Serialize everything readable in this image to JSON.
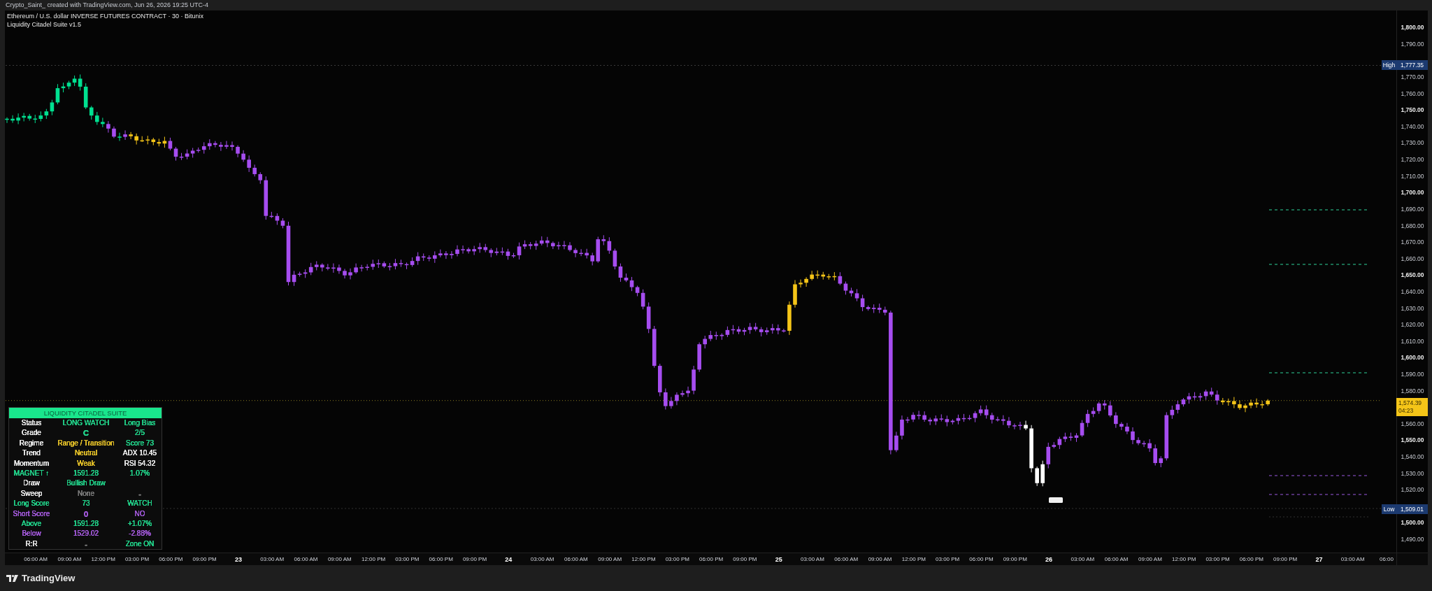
{
  "caption": "Crypto_Saint_ created with TradingView.com, Jun 26, 2026 19:25 UTC-4",
  "legend": {
    "symbol": "Ethereum / U.S. dollar INVERSE FUTURES CONTRACT · 30 · Bitunix",
    "indicator": "Liquidity Citadel Suite v1.5"
  },
  "table": {
    "title": "LIQUIDITY CITADEL SUITE",
    "rows": [
      {
        "cells": [
          {
            "text": "Status",
            "color": "#e8e8e8"
          },
          {
            "text": "LONG WATCH",
            "color": "#22d38a"
          },
          {
            "text": "Long Bias",
            "color": "#22d38a"
          }
        ]
      },
      {
        "cells": [
          {
            "text": "Grade",
            "color": "#e8e8e8"
          },
          {
            "text": "C",
            "color": "#22d38a"
          },
          {
            "text": "2/5",
            "color": "#22d38a"
          }
        ]
      },
      {
        "cells": [
          {
            "text": "Regime",
            "color": "#e8e8e8"
          },
          {
            "text": "Range / Transition",
            "color": "#e6c229"
          },
          {
            "text": "Score 73",
            "color": "#22d38a"
          }
        ]
      },
      {
        "cells": [
          {
            "text": "Trend",
            "color": "#e8e8e8"
          },
          {
            "text": "Neutral",
            "color": "#e6c229"
          },
          {
            "text": "ADX 10.45",
            "color": "#e8e8e8"
          }
        ]
      },
      {
        "cells": [
          {
            "text": "Momentum",
            "color": "#e8e8e8"
          },
          {
            "text": "Weak",
            "color": "#e6c229"
          },
          {
            "text": "RSI 54.32",
            "color": "#e8e8e8"
          }
        ]
      },
      {
        "cells": [
          {
            "text": "MAGNET ↑",
            "color": "#22d38a"
          },
          {
            "text": "1591.28",
            "color": "#22d38a"
          },
          {
            "text": "1.07%",
            "color": "#22d38a"
          }
        ]
      },
      {
        "cells": [
          {
            "text": "Draw",
            "color": "#e8e8e8"
          },
          {
            "text": "Bullish Draw",
            "color": "#22d38a"
          }
        ]
      },
      {
        "cells": [
          {
            "text": "Sweep",
            "color": "#e8e8e8"
          },
          {
            "text": "None",
            "color": "#7a7a7a"
          },
          {
            "text": "-",
            "color": "#7a7a7a"
          }
        ]
      },
      {
        "cells": [
          {
            "text": "Long Score",
            "color": "#22d38a"
          },
          {
            "text": "73",
            "color": "#22d38a"
          },
          {
            "text": "WATCH",
            "color": "#22d38a"
          }
        ]
      },
      {
        "cells": [
          {
            "text": "Short Score",
            "color": "#a259d9"
          },
          {
            "text": "0",
            "color": "#a259d9"
          },
          {
            "text": "NO",
            "color": "#a259d9"
          }
        ]
      },
      {
        "cells": [
          {
            "text": "Above",
            "color": "#22d38a"
          },
          {
            "text": "1591.28",
            "color": "#22d38a"
          },
          {
            "text": "+1.07%",
            "color": "#22d38a"
          }
        ]
      },
      {
        "cells": [
          {
            "text": "Below",
            "color": "#a259d9"
          },
          {
            "text": "1529.02",
            "color": "#a259d9"
          },
          {
            "text": "-2.88%",
            "color": "#a259d9"
          }
        ]
      },
      {
        "cells": [
          {
            "text": "R:R",
            "color": "#e8e8e8"
          },
          {
            "text": "-",
            "color": "#7a7a7a"
          },
          {
            "text": "Zone ON",
            "color": "#22d38a"
          }
        ]
      }
    ]
  },
  "price_axis": {
    "items": [
      {
        "kind": "tick",
        "label": "1,800.00",
        "major": true
      },
      {
        "kind": "tick",
        "label": "1,790.00",
        "major": false
      },
      {
        "kind": "high",
        "label": "High",
        "price": "1,777.35"
      },
      {
        "kind": "tick",
        "label": "1,770.00",
        "major": false
      },
      {
        "label": "1,760.00",
        "major": false
      },
      {
        "label": "1,750.00",
        "major": true
      },
      {
        "label": "1,740.00",
        "major": false
      },
      {
        "label": "1,730.00",
        "major": false
      },
      {
        "label": "1,720.00",
        "major": false
      },
      {
        "label": "1,710.00",
        "major": false
      },
      {
        "label": "1,700.00",
        "major": true
      },
      {
        "label": "1,690.00",
        "major": false
      },
      {
        "label": "1,680.00",
        "major": false
      },
      {
        "label": "1,670.00",
        "major": false
      },
      {
        "label": "1,660.00",
        "major": false
      },
      {
        "label": "1,650.00",
        "major": true
      },
      {
        "label": "1,640.00",
        "major": false
      },
      {
        "label": "1,630.00",
        "major": false
      },
      {
        "label": "1,620.00",
        "major": false
      },
      {
        "label": "1,610.00",
        "major": false
      },
      {
        "label": "1,600.00",
        "major": true
      },
      {
        "label": "1,590.00",
        "major": false
      },
      {
        "label": "1,580.00",
        "major": false
      },
      {
        "kind": "last",
        "price": "1,574.39",
        "countdown": "04:23"
      },
      {
        "label": "1,560.00",
        "major": false
      },
      {
        "label": "1,550.00",
        "major": true
      },
      {
        "label": "1,540.00",
        "major": false
      },
      {
        "label": "1,530.00",
        "major": false
      },
      {
        "label": "1,520.00",
        "major": false
      },
      {
        "kind": "low",
        "label": "Low",
        "price": "1,509.01"
      },
      {
        "label": "1,500.00",
        "major": true
      },
      {
        "label": "1,490.00",
        "major": false
      }
    ]
  },
  "time_axis": {
    "ticks": [
      {
        "label": "06:00 AM",
        "major": false
      },
      {
        "label": "09:00 AM",
        "major": false
      },
      {
        "label": "12:00 PM",
        "major": false
      },
      {
        "label": "03:00 PM",
        "major": false
      },
      {
        "label": "06:00 PM",
        "major": false
      },
      {
        "label": "09:00 PM",
        "major": false
      },
      {
        "label": "23",
        "major": true
      },
      {
        "label": "03:00 AM",
        "major": false
      },
      {
        "label": "06:00 AM",
        "major": false
      },
      {
        "label": "09:00 AM",
        "major": false
      },
      {
        "label": "12:00 PM",
        "major": false
      },
      {
        "label": "03:00 PM",
        "major": false
      },
      {
        "label": "06:00 PM",
        "major": false
      },
      {
        "label": "09:00 PM",
        "major": false
      },
      {
        "label": "24",
        "major": true
      },
      {
        "label": "03:00 AM",
        "major": false
      },
      {
        "label": "06:00 AM",
        "major": false
      },
      {
        "label": "09:00 AM",
        "major": false
      },
      {
        "label": "12:00 PM",
        "major": false
      },
      {
        "label": "03:00 PM",
        "major": false
      },
      {
        "label": "06:00 PM",
        "major": false
      },
      {
        "label": "09:00 PM",
        "major": false
      },
      {
        "label": "25",
        "major": true
      },
      {
        "label": "03:00 AM",
        "major": false
      },
      {
        "label": "06:00 AM",
        "major": false
      },
      {
        "label": "09:00 AM",
        "major": false
      },
      {
        "label": "12:00 PM",
        "major": false
      },
      {
        "label": "03:00 PM",
        "major": false
      },
      {
        "label": "06:00 PM",
        "major": false
      },
      {
        "label": "09:00 PM",
        "major": false
      },
      {
        "label": "26",
        "major": true
      },
      {
        "label": "03:00 AM",
        "major": false
      },
      {
        "label": "06:00 AM",
        "major": false
      },
      {
        "label": "09:00 AM",
        "major": false
      },
      {
        "label": "12:00 PM",
        "major": false
      },
      {
        "label": "03:00 PM",
        "major": false
      },
      {
        "label": "06:00 PM",
        "major": false
      },
      {
        "label": "09:00 PM",
        "major": false
      },
      {
        "label": "27",
        "major": true
      },
      {
        "label": "03:00 AM",
        "major": false
      },
      {
        "label": "06:00",
        "major": false
      }
    ]
  },
  "footer": {
    "brand": "TradingView"
  }
}
